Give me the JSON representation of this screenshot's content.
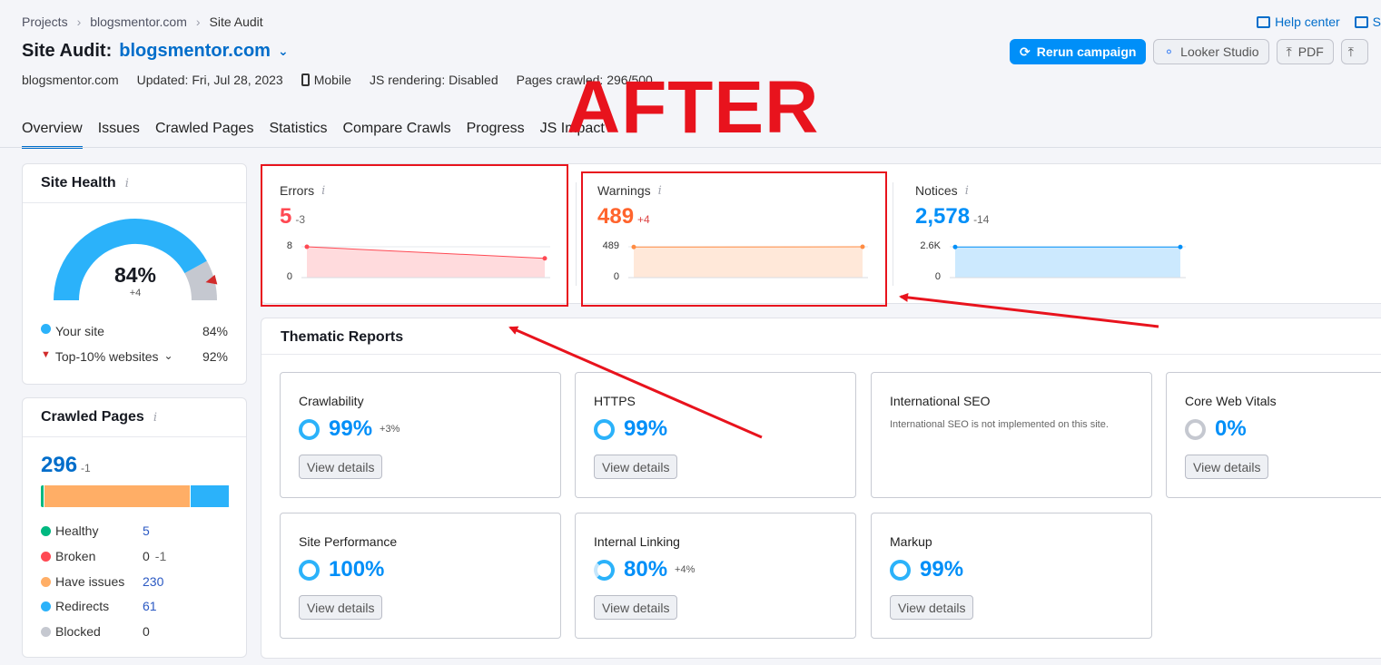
{
  "breadcrumbs": [
    "Projects",
    "blogsmentor.com",
    "Site Audit"
  ],
  "header": {
    "title_prefix": "Site Audit:",
    "domain": "blogsmentor.com",
    "meta": {
      "domain": "blogsmentor.com",
      "updated": "Updated: Fri, Jul 28, 2023",
      "device": "Mobile",
      "js_rendering": "JS rendering: Disabled",
      "pages_crawled": "Pages crawled: 296/500"
    },
    "links": {
      "help": "Help center",
      "send": "S"
    },
    "buttons": {
      "rerun": "Rerun campaign",
      "looker": "Looker Studio",
      "pdf": "PDF"
    }
  },
  "tabs": [
    "Overview",
    "Issues",
    "Crawled Pages",
    "Statistics",
    "Compare Crawls",
    "Progress",
    "JS Impact"
  ],
  "annotation": {
    "text": "AFTER"
  },
  "site_health": {
    "title": "Site Health",
    "value": "84%",
    "delta": "+4",
    "fraction": 0.84,
    "your_site_label": "Your site",
    "your_site_value": "84%",
    "top10_label": "Top-10% websites",
    "top10_value": "92%",
    "colors": {
      "main": "#2bb2fa",
      "rest": "#c5c8d0",
      "marker": "#d12b2b"
    }
  },
  "crawled_pages": {
    "title": "Crawled Pages",
    "total": "296",
    "delta": "-1",
    "bar": [
      {
        "name": "Healthy",
        "value": 5,
        "color": "#00b880"
      },
      {
        "name": "Broken",
        "value": 0,
        "color": "#ff4953"
      },
      {
        "name": "Have issues",
        "value": 230,
        "color": "#ffae66"
      },
      {
        "name": "Redirects",
        "value": 61,
        "color": "#2bb2fa"
      },
      {
        "name": "Blocked",
        "value": 0,
        "color": "#c5c8d0"
      }
    ],
    "rows": [
      {
        "label": "Healthy",
        "value": "5",
        "delta": ""
      },
      {
        "label": "Broken",
        "value": "0",
        "delta": "-1"
      },
      {
        "label": "Have issues",
        "value": "230",
        "delta": ""
      },
      {
        "label": "Redirects",
        "value": "61",
        "delta": ""
      },
      {
        "label": "Blocked",
        "value": "0",
        "delta": ""
      }
    ]
  },
  "issues": {
    "errors": {
      "label": "Errors",
      "value": "5",
      "delta": "-3",
      "ytop": "8",
      "ybottom": "0",
      "color": "#ff4953"
    },
    "warnings": {
      "label": "Warnings",
      "value": "489",
      "delta": "+4",
      "ytop": "489",
      "ybottom": "0",
      "color": "#ff8c43"
    },
    "notices": {
      "label": "Notices",
      "value": "2,578",
      "delta": "-14",
      "ytop": "2.6K",
      "ybottom": "0",
      "color": "#008ff8"
    }
  },
  "chart_data": [
    {
      "type": "area",
      "title": "Errors",
      "x": [
        1,
        2
      ],
      "values": [
        8,
        5
      ],
      "ylim": [
        0,
        8
      ]
    },
    {
      "type": "area",
      "title": "Warnings",
      "x": [
        1,
        2
      ],
      "values": [
        485,
        489
      ],
      "ylim": [
        0,
        489
      ]
    },
    {
      "type": "area",
      "title": "Notices",
      "x": [
        1,
        2
      ],
      "values": [
        2578,
        2578
      ],
      "ylim": [
        0,
        2600
      ]
    }
  ],
  "thematic": {
    "title": "Thematic Reports",
    "view_label": "View details",
    "reports": [
      {
        "name": "Crawlability",
        "pct": "99%",
        "delta": "+3%"
      },
      {
        "name": "HTTPS",
        "pct": "99%",
        "delta": ""
      },
      {
        "name": "International SEO",
        "note": "International SEO is not implemented on this site."
      },
      {
        "name": "Core Web Vitals",
        "pct": "0%",
        "delta": ""
      },
      {
        "name": "Site Performance",
        "pct": "100%",
        "delta": ""
      },
      {
        "name": "Internal Linking",
        "pct": "80%",
        "delta": "+4%"
      },
      {
        "name": "Markup",
        "pct": "99%",
        "delta": ""
      }
    ]
  }
}
